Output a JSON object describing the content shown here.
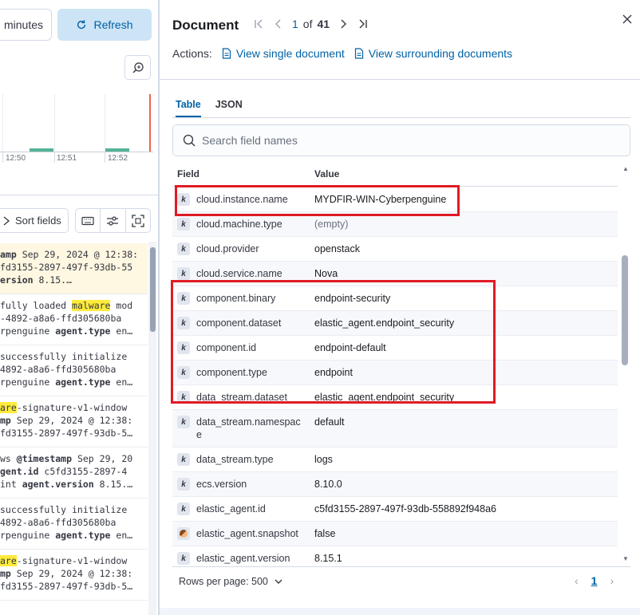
{
  "left": {
    "time_button_label": "minutes",
    "refresh_label": "Refresh",
    "tick_labels": [
      "12:50",
      "12:51",
      "12:52"
    ],
    "sort_fields_label": "Sort fields",
    "rows": [
      {
        "line1_k": "amp",
        "line1_v": " Sep 29, 2024 @ 12:38:",
        "line2": "fd3155-2897-497f-93db-55",
        "line3_k": "ersion",
        "line3_v": " 8.15.…"
      },
      {
        "line1_a": "fully loaded ",
        "line1_m": "malware",
        "line1_b": " mod",
        "line2": "-4892-a8a6-ffd305680ba",
        "line3_a": "rpenguine ",
        "line3_k": "agent.type",
        "line3_b": " en…"
      },
      {
        "line1": "successfully initialize",
        "line2": "4892-a8a6-ffd305680ba",
        "line3_a": "rpenguine ",
        "line3_k": "agent.type",
        "line3_b": " en…"
      },
      {
        "line1_m": "are",
        "line1_b": "-signature-v1-window",
        "line2_k": "mp",
        "line2_v": " Sep 29, 2024 @ 12:38:",
        "line3": "fd3155-2897-497f-93db-5…"
      },
      {
        "line1_a": "ws ",
        "line1_k": "@timestamp",
        "line1_b": " Sep 29, 20",
        "line2_k": "gent.id",
        "line2_v": " c5fd3155-2897-4",
        "line3_a": "int ",
        "line3_k": "agent.version",
        "line3_b": " 8.15.…"
      },
      {
        "line1": "successfully initialize",
        "line2": "4892-a8a6-ffd305680ba",
        "line3_a": "rpenguine ",
        "line3_k": "agent.type",
        "line3_b": " en…"
      },
      {
        "line1_m": "are",
        "line1_b": "-signature-v1-window",
        "line2_k": "mp",
        "line2_v": " Sep 29, 2024 @ 12:38:",
        "line3": "fd3155-2897-497f-93db-5…"
      }
    ]
  },
  "flyout": {
    "title": "Document",
    "pager": {
      "current": "1",
      "of_label": "of",
      "total": "41"
    },
    "actions_label": "Actions:",
    "action_single": "View single document",
    "action_surrounding": "View surrounding documents",
    "tabs": [
      "Table",
      "JSON"
    ],
    "search_placeholder": "Search field names",
    "col_field": "Field",
    "col_value": "Value",
    "fields": [
      {
        "type": "k",
        "name": "cloud.instance.name",
        "value": "MYDFIR-WIN-Cyberpenguine"
      },
      {
        "type": "k",
        "name": "cloud.machine.type",
        "value": "(empty)"
      },
      {
        "type": "k",
        "name": "cloud.provider",
        "value": "openstack"
      },
      {
        "type": "k",
        "name": "cloud.service.name",
        "value": "Nova"
      },
      {
        "type": "k",
        "name": "component.binary",
        "value": "endpoint-security"
      },
      {
        "type": "k",
        "name": "component.dataset",
        "value": "elastic_agent.endpoint_security"
      },
      {
        "type": "k",
        "name": "component.id",
        "value": "endpoint-default"
      },
      {
        "type": "k",
        "name": "component.type",
        "value": "endpoint"
      },
      {
        "type": "k",
        "name": "data_stream.dataset",
        "value": "elastic_agent.endpoint_security"
      },
      {
        "type": "k",
        "name": "data_stream.namespace",
        "value": "default"
      },
      {
        "type": "k",
        "name": "data_stream.type",
        "value": "logs"
      },
      {
        "type": "k",
        "name": "ecs.version",
        "value": "8.10.0"
      },
      {
        "type": "k",
        "name": "elastic_agent.id",
        "value": "c5fd3155-2897-497f-93db-558892f948a6"
      },
      {
        "type": "bool",
        "name": "elastic_agent.snapshot",
        "value": "false"
      },
      {
        "type": "k",
        "name": "elastic_agent.version",
        "value": "8.15.1"
      }
    ],
    "rows_per_page_label": "Rows per page: 500",
    "page_number": "1"
  },
  "colors": {
    "accent": "#0061a6",
    "highlight_box": "#e01b24",
    "histogram_bar": "#54b399"
  }
}
